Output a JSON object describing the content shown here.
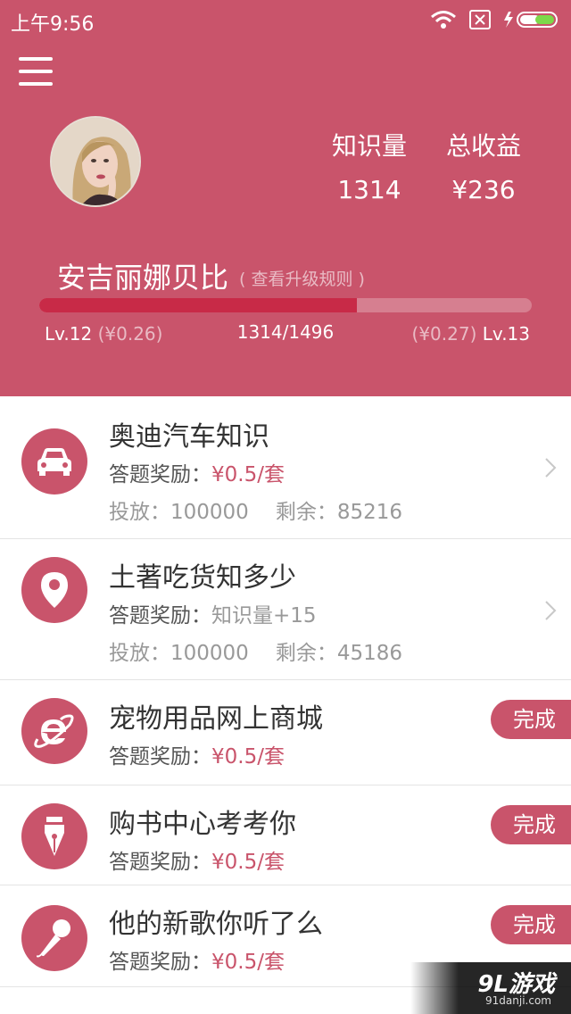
{
  "status_bar": {
    "time": "上午9:56"
  },
  "profile": {
    "name": "安吉丽娜贝比",
    "rules_link": "( 查看升级规则 )",
    "stats": [
      {
        "label": "知识量",
        "value": "1314"
      },
      {
        "label": "总收益",
        "value": "¥236"
      }
    ],
    "level": {
      "current_lv": "Lv.12",
      "current_rate": "(¥0.26)",
      "progress_text": "1314/1496",
      "progress_fraction": 0.645,
      "next_rate": "(¥0.27)",
      "next_lv": "Lv.13"
    }
  },
  "tasks": [
    {
      "title": "奥迪汽车知识",
      "reward_label": "答题奖励：",
      "reward_value": "¥0.5/套",
      "placed_label": "投放：100000",
      "remaining_label": "剩余：85216",
      "icon": "car-icon"
    },
    {
      "title": "土著吃货知多少",
      "reward_label": "答题奖励：",
      "reward_value": "知识量+15",
      "placed_label": "投放：100000",
      "remaining_label": "剩余：45186",
      "icon": "location-pin-icon"
    },
    {
      "title": "宠物用品网上商城",
      "reward_label": "答题奖励：",
      "reward_value": "¥0.5/套",
      "done_label": "完成",
      "icon": "internet-explorer-icon"
    },
    {
      "title": "购书中心考考你",
      "reward_label": "答题奖励：",
      "reward_value": "¥0.5/套",
      "done_label": "完成",
      "icon": "fountain-pen-icon"
    },
    {
      "title": "他的新歌你听了么",
      "reward_label": "答题奖励：",
      "reward_value": "¥0.5/套",
      "done_label": "完成",
      "icon": "microphone-icon"
    }
  ],
  "watermark": {
    "main": "9L游戏",
    "sub": "91danji.com"
  },
  "colors": {
    "primary": "#c9546b",
    "progress_fill": "#c82a47"
  }
}
